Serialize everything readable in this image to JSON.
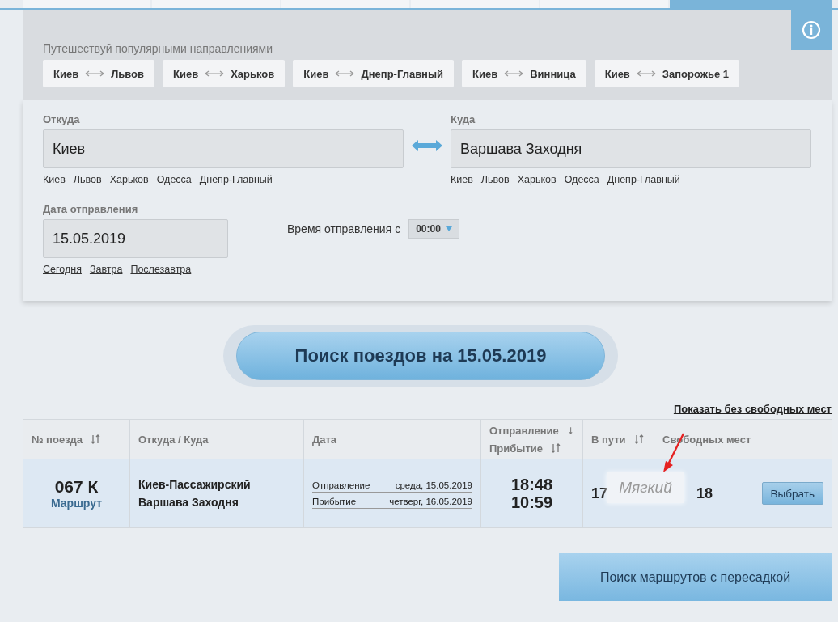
{
  "top_tabs": [
    {
      "selected": false
    },
    {
      "selected": false
    },
    {
      "selected": false
    },
    {
      "selected": false
    },
    {
      "selected": false
    },
    {
      "selected": true
    }
  ],
  "popular": {
    "title": "Путешествуй популярными направлениями",
    "routes": [
      {
        "from": "Киев",
        "to": "Львов"
      },
      {
        "from": "Киев",
        "to": "Харьков"
      },
      {
        "from": "Киев",
        "to": "Днепр-Главный"
      },
      {
        "from": "Киев",
        "to": "Винница"
      },
      {
        "from": "Киев",
        "to": "Запорожье 1"
      }
    ]
  },
  "form": {
    "from": {
      "label": "Откуда",
      "value": "Киев",
      "quick_links": [
        "Киев",
        "Львов",
        "Харьков",
        "Одесса",
        "Днепр-Главный"
      ]
    },
    "to": {
      "label": "Куда",
      "value": "Варшава Заходня",
      "quick_links": [
        "Киев",
        "Львов",
        "Харьков",
        "Одесса",
        "Днепр-Главный"
      ]
    },
    "date": {
      "label": "Дата отправления",
      "value": "15.05.2019",
      "quick_links": [
        "Сегодня",
        "Завтра",
        "Послезавтра"
      ]
    },
    "time": {
      "label": "Время отправления с",
      "value": "00:00"
    }
  },
  "search_button": "Поиск поездов на 15.05.2019",
  "show_all_link": "Показать без свободных мест",
  "table": {
    "columns": [
      {
        "lines": [
          {
            "text": "№ поезда",
            "kind": "sortable"
          }
        ]
      },
      {
        "lines": [
          {
            "text": "Откуда / Куда",
            "kind": "plain"
          }
        ]
      },
      {
        "lines": [
          {
            "text": "Дата",
            "kind": "plain"
          }
        ]
      },
      {
        "lines": [
          {
            "text": "Отправление",
            "kind": "sorted"
          },
          {
            "text": "Прибытие",
            "kind": "sortable"
          }
        ]
      },
      {
        "lines": [
          {
            "text": "В пути",
            "kind": "sortable"
          }
        ]
      },
      {
        "lines": [
          {
            "text": "Свободных мест",
            "kind": "plain"
          }
        ]
      }
    ],
    "rows": [
      {
        "train": "067 К",
        "route_link": "Маршрут",
        "from": "Киев-Пассажирский",
        "to": "Варшава Заходня",
        "dates": [
          {
            "label": "Отправление",
            "value": "среда, 15.05.2019"
          },
          {
            "label": "Прибытие",
            "value": "четверг, 16.05.2019"
          }
        ],
        "departure_time": "18:48",
        "arrival_time": "10:59",
        "duration": "17",
        "seats": "18",
        "select_button": "Выбрать",
        "tooltip": "Мягкий"
      }
    ]
  },
  "transfer_button": "Поиск маршрутов с пересадкой"
}
